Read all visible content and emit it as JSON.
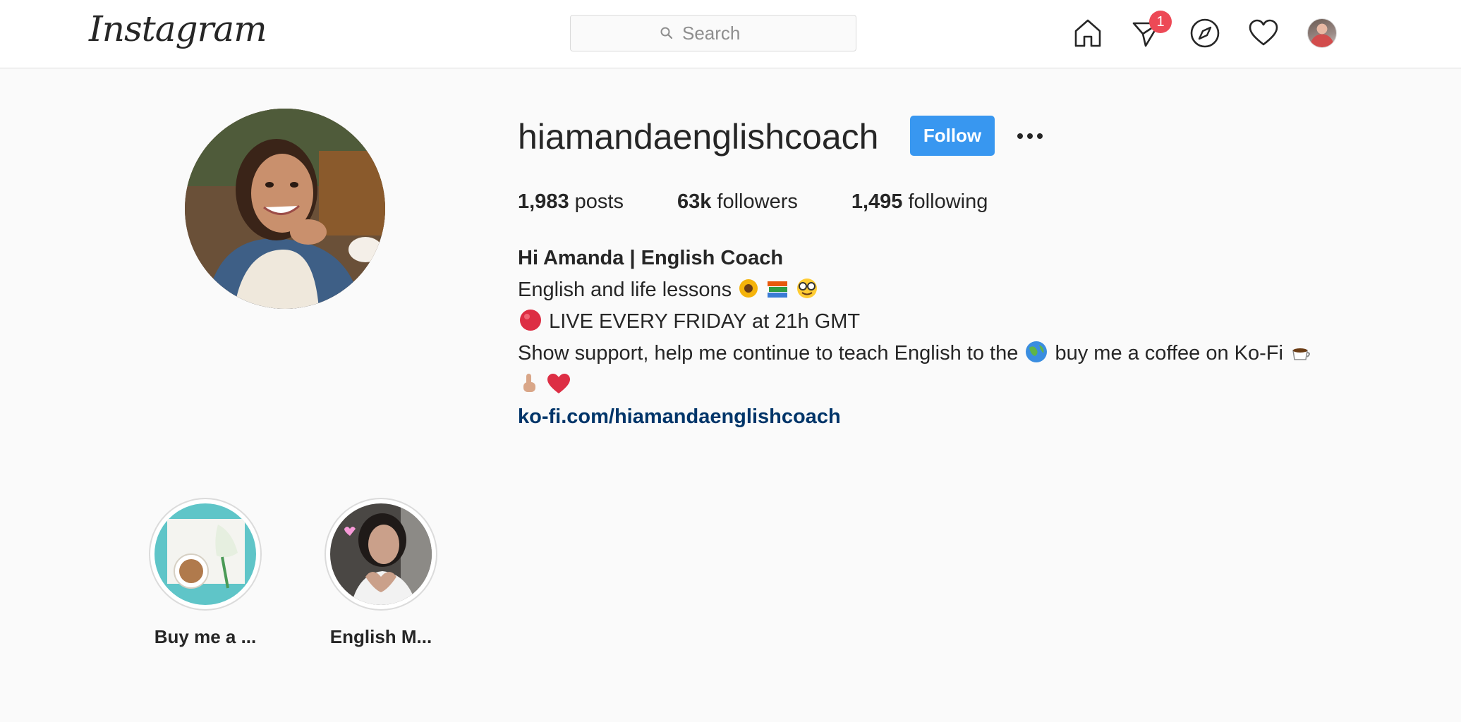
{
  "app": {
    "logo": "Instagram"
  },
  "search": {
    "placeholder": "Search"
  },
  "nav": {
    "items": [
      {
        "name": "home",
        "icon": "home-icon"
      },
      {
        "name": "direct",
        "icon": "paper-plane-icon",
        "badge": "1"
      },
      {
        "name": "explore",
        "icon": "compass-icon"
      },
      {
        "name": "activity",
        "icon": "heart-icon"
      },
      {
        "name": "profile",
        "icon": "avatar"
      }
    ]
  },
  "profile": {
    "username": "hiamandaenglishcoach",
    "follow_label": "Follow",
    "stats": {
      "posts_count": "1,983",
      "posts_label": "posts",
      "followers_count": "63k",
      "followers_label": "followers",
      "following_count": "1,495",
      "following_label": "following"
    },
    "bio": {
      "name": "Hi Amanda | English Coach",
      "line1": "English and life lessons",
      "line2": "LIVE EVERY FRIDAY at 21h GMT",
      "line3a": "Show support, help me continue to teach English to the",
      "line3b": "buy me a coffee on Ko-Fi",
      "link": "ko-fi.com/hiamandaenglishcoach"
    }
  },
  "highlights": [
    {
      "label": "Buy me a ..."
    },
    {
      "label": "English M..."
    }
  ],
  "colors": {
    "accent": "#3897f0",
    "badge": "#ed4956",
    "link": "#003569",
    "border": "#dbdbdb",
    "background": "#fafafa"
  }
}
